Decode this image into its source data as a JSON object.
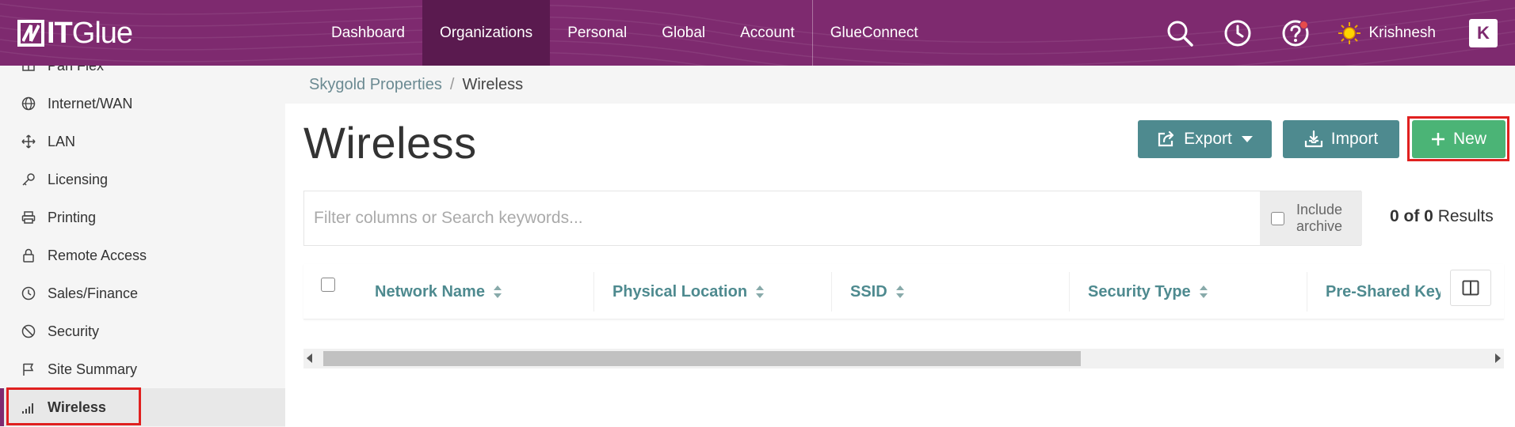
{
  "brand": {
    "logo_strong": "IT",
    "logo_light": "Glue"
  },
  "nav": {
    "items": [
      {
        "label": "Dashboard"
      },
      {
        "label": "Organizations",
        "active": true
      },
      {
        "label": "Personal"
      },
      {
        "label": "Global"
      },
      {
        "label": "Account"
      },
      {
        "label": "GlueConnect"
      }
    ]
  },
  "topbar": {
    "icons": [
      "search-icon",
      "history-icon",
      "help-icon"
    ],
    "user_name": "Krishnesh",
    "app_badge": "K",
    "colors": {
      "bar": "#7e2a6f",
      "active_nav": "#5a1a4f"
    }
  },
  "sidebar": {
    "items": [
      {
        "label": "Pan Flex",
        "icon": "patch-panel-icon"
      },
      {
        "label": "Internet/WAN",
        "icon": "globe-icon"
      },
      {
        "label": "LAN",
        "icon": "move-arrows-icon"
      },
      {
        "label": "Licensing",
        "icon": "key-icon"
      },
      {
        "label": "Printing",
        "icon": "printer-icon"
      },
      {
        "label": "Remote Access",
        "icon": "lock-icon"
      },
      {
        "label": "Sales/Finance",
        "icon": "clock-icon"
      },
      {
        "label": "Security",
        "icon": "ban-icon"
      },
      {
        "label": "Site Summary",
        "icon": "flag-icon"
      },
      {
        "label": "Wireless",
        "icon": "signal-bars-icon",
        "active": true
      }
    ]
  },
  "breadcrumb": {
    "parent": "Skygold Properties",
    "separator": "/",
    "current": "Wireless"
  },
  "page": {
    "title": "Wireless",
    "buttons": {
      "export": "Export",
      "import": "Import",
      "new": "New"
    },
    "colors": {
      "teal": "#4e8a8f",
      "green": "#4bb476",
      "highlight": "#e0201f"
    }
  },
  "filter": {
    "placeholder": "Filter columns or Search keywords...",
    "include_archive": "Include archive",
    "results_count": "0 of 0",
    "results_label": " Results"
  },
  "table": {
    "columns": [
      "Network Name",
      "Physical Location",
      "SSID",
      "Security Type",
      "Pre-Shared Key"
    ]
  }
}
